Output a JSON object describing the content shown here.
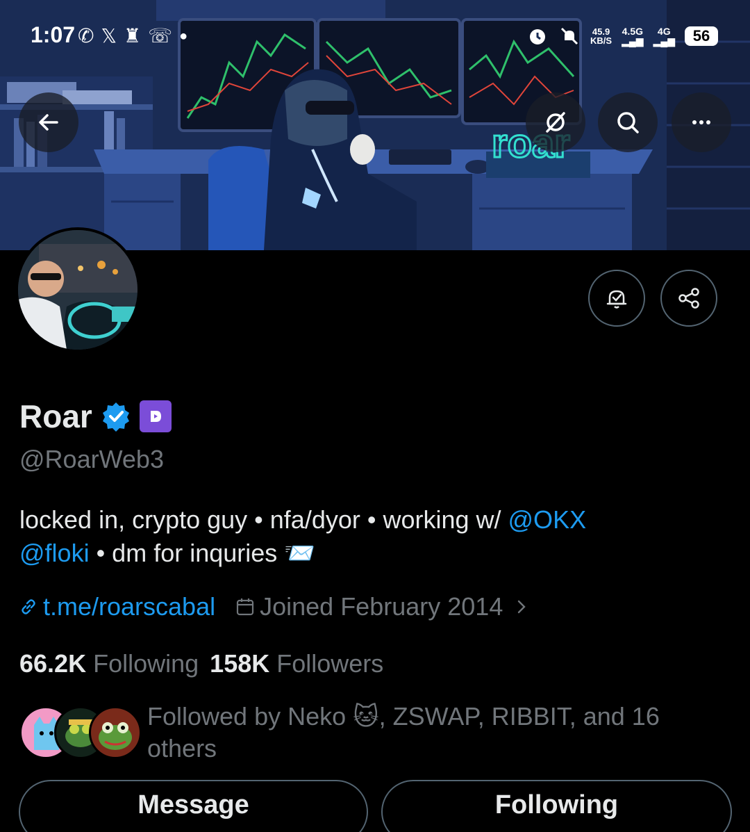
{
  "status_bar": {
    "time": "1:07",
    "net_speed_value": "45.9",
    "net_speed_unit": "KB/S",
    "network_1": "4.5G",
    "network_2": "4G",
    "battery": "56"
  },
  "banner": {
    "neon_sign_text": "roar"
  },
  "profile": {
    "display_name": "Roar",
    "handle": "@RoarWeb3",
    "bio_part1": "locked in, crypto guy • nfa/dyor • working w/ ",
    "bio_mention1": "@OKX",
    "bio_mention2": "@floki",
    "bio_part2": " • dm for inquries 📨",
    "link": "t.me/roarscabal",
    "joined": "Joined February 2014",
    "following_count": "66.2K",
    "following_label": "Following",
    "followers_count": "158K",
    "followers_label": "Followers",
    "followed_by": "Followed by Neko 🐱, ZSWAP, RIBBIT, and 16 others"
  },
  "actions": {
    "message_label": "Message",
    "following_label": "Following"
  },
  "colors": {
    "accent": "#1d9bf0",
    "muted": "#71767b",
    "text": "#e7e9ea",
    "background": "#000000",
    "affiliate_badge": "#7b4dd8"
  },
  "icons": {
    "back": "arrow-left-icon",
    "grok": "grok-icon",
    "search": "search-icon",
    "more": "more-icon",
    "notify": "bell-check-icon",
    "share": "share-icon",
    "link": "link-icon",
    "calendar": "calendar-icon",
    "chevron": "chevron-right-icon"
  }
}
